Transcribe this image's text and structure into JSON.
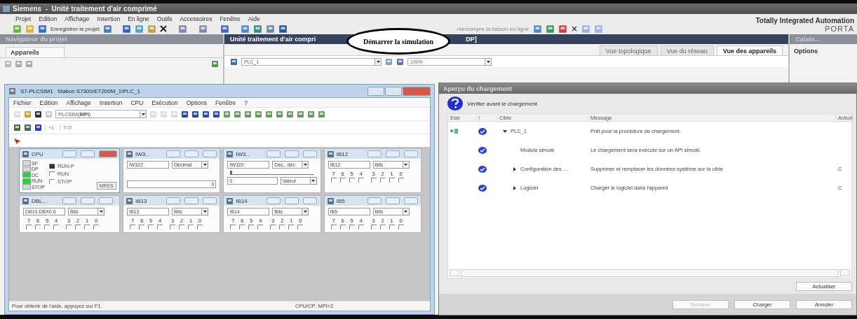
{
  "app": {
    "title": "Siemens  -  Unité traitement d'air comprimé",
    "brand": "Totally Integrated Automation",
    "brand_sub": "PORTA"
  },
  "menu": [
    "Projet",
    "Edition",
    "Affichage",
    "Insertion",
    "En ligne",
    "Outils",
    "Accessoires",
    "Fenêtre",
    "Aide"
  ],
  "toolbar": {
    "save_label": "Enregistrer le projet",
    "online_label": "nterrompre la liaison en ligne"
  },
  "callout": {
    "text": "Démarrer la simulation"
  },
  "navigator": {
    "title": "Navigateur du projet",
    "tab": "Appareils"
  },
  "editor": {
    "title": "Unité traitement d'air compri",
    "title_end": "DP]",
    "device": "PLC_1",
    "zoom": "100%",
    "views": [
      {
        "label": "Vue topologique",
        "selected": false
      },
      {
        "label": "Vue du réseau",
        "selected": false
      },
      {
        "label": "Vue des appareils",
        "selected": true
      }
    ]
  },
  "catalog": {
    "title": "Catalo...",
    "section": "Options"
  },
  "plcsim": {
    "title": "S7-PLCSIM1",
    "station": "Station S7300/ET200M_1\\PLC_1",
    "menu": [
      "Fichier",
      "Edition",
      "Affichage",
      "Insertion",
      "CPU",
      "Exécution",
      "Options",
      "Fenêtre",
      "?"
    ],
    "access": "PLCSIM(**MPI**)",
    "step_labels": [
      "+1",
      "T=0"
    ],
    "cpu": {
      "title": "CPU",
      "mres": "MRES",
      "leds": [
        {
          "label": "SF",
          "on": false
        },
        {
          "label": "DP",
          "on": false
        },
        {
          "label": "DC",
          "on": true
        },
        {
          "label": "RUN",
          "on": true
        },
        {
          "label": "STOP",
          "on": false
        }
      ],
      "modes": [
        {
          "label": "RUN-P",
          "checked": true
        },
        {
          "label": "RUN",
          "checked": false
        },
        {
          "label": "STOP",
          "checked": false
        }
      ]
    },
    "modules": [
      {
        "kind": "value",
        "title": "IW3...",
        "address": "IW322",
        "format": "Décimal",
        "value": "0"
      },
      {
        "kind": "slider",
        "title": "IW3...",
        "address": "IW320",
        "format": "Déc., déc",
        "level": 0,
        "value": "0",
        "mode": "Valeur"
      },
      {
        "kind": "bits",
        "title": "IB12",
        "address": "IB12",
        "format": "Bits",
        "bits": [
          {
            "label": "7",
            "checked": false
          },
          {
            "label": "6",
            "checked": false
          },
          {
            "label": "5",
            "checked": false
          },
          {
            "label": "4",
            "checked": false
          },
          {
            "label": "3",
            "checked": false
          },
          {
            "label": "2",
            "checked": false
          },
          {
            "label": "1",
            "checked": false
          },
          {
            "label": "0",
            "checked": false
          }
        ]
      },
      {
        "kind": "bits",
        "title": "DBL...",
        "address": "DB10.DBX0.6",
        "format": "Bits",
        "bits": [
          {
            "label": "7",
            "checked": false
          },
          {
            "label": "6",
            "checked": false
          },
          {
            "label": "5",
            "checked": false
          },
          {
            "label": "4",
            "checked": false
          },
          {
            "label": "3",
            "checked": false
          },
          {
            "label": "2",
            "checked": false
          },
          {
            "label": "1",
            "checked": false
          },
          {
            "label": "0",
            "checked": false
          }
        ]
      },
      {
        "kind": "bits",
        "title": "IB13",
        "address": "IB13",
        "format": "Bits",
        "bits": [
          {
            "label": "7",
            "checked": false
          },
          {
            "label": "6",
            "checked": false
          },
          {
            "label": "5",
            "checked": false
          },
          {
            "label": "4",
            "checked": false
          },
          {
            "label": "3",
            "checked": false
          },
          {
            "label": "2",
            "checked": false
          },
          {
            "label": "1",
            "checked": false
          },
          {
            "label": "0",
            "checked": false
          }
        ]
      },
      {
        "kind": "bits",
        "title": "IB14",
        "address": "IB14",
        "format": "Bits",
        "bits": [
          {
            "label": "7",
            "checked": false
          },
          {
            "label": "6",
            "checked": false
          },
          {
            "label": "5",
            "checked": false
          },
          {
            "label": "4",
            "checked": false
          },
          {
            "label": "3",
            "checked": false
          },
          {
            "label": "2",
            "checked": false
          },
          {
            "label": "1",
            "checked": false
          },
          {
            "label": "0",
            "checked": false
          }
        ]
      },
      {
        "kind": "bits",
        "title": "IB5",
        "address": "IB5",
        "format": "Bits",
        "bits": [
          {
            "label": "7",
            "checked": false
          },
          {
            "label": "6",
            "checked": false
          },
          {
            "label": "5",
            "checked": false
          },
          {
            "label": "4",
            "checked": false
          },
          {
            "label": "3",
            "checked": false
          },
          {
            "label": "2",
            "checked": false
          },
          {
            "label": "1",
            "checked": false
          },
          {
            "label": "0",
            "checked": false
          }
        ]
      }
    ],
    "status": "Pour obtenir de l'aide, appuyez sur F1.",
    "status_cpu": "CPU/CP:  MPI=2"
  },
  "dialog": {
    "title": "Aperçu du chargement",
    "prompt": "Vérifier avant le chargement",
    "columns": [
      "Etat",
      "!",
      "Cible",
      "Message",
      "Action"
    ],
    "rows": [
      {
        "target": "PLC_1",
        "expanded": true,
        "message": "Prêt pour la procédure de chargement.",
        "children": [
          {
            "target": "Module simulé",
            "message": "Le chargement sera exécuté sur un API simulé."
          },
          {
            "target": "Configuration des ...",
            "expanded": false,
            "message": "Supprimer et remplacer les données système sur la cible",
            "action": "C"
          },
          {
            "target": "Logiciel",
            "expanded": false,
            "message": "Charger le logiciel dans l'appareil",
            "action": "C"
          }
        ]
      }
    ],
    "buttons": [
      {
        "label": "Actualiser",
        "disabled": false
      },
      {
        "label": "Terminer",
        "disabled": true
      },
      {
        "label": "Charger",
        "disabled": false
      },
      {
        "label": "Annuler",
        "disabled": false
      }
    ]
  }
}
